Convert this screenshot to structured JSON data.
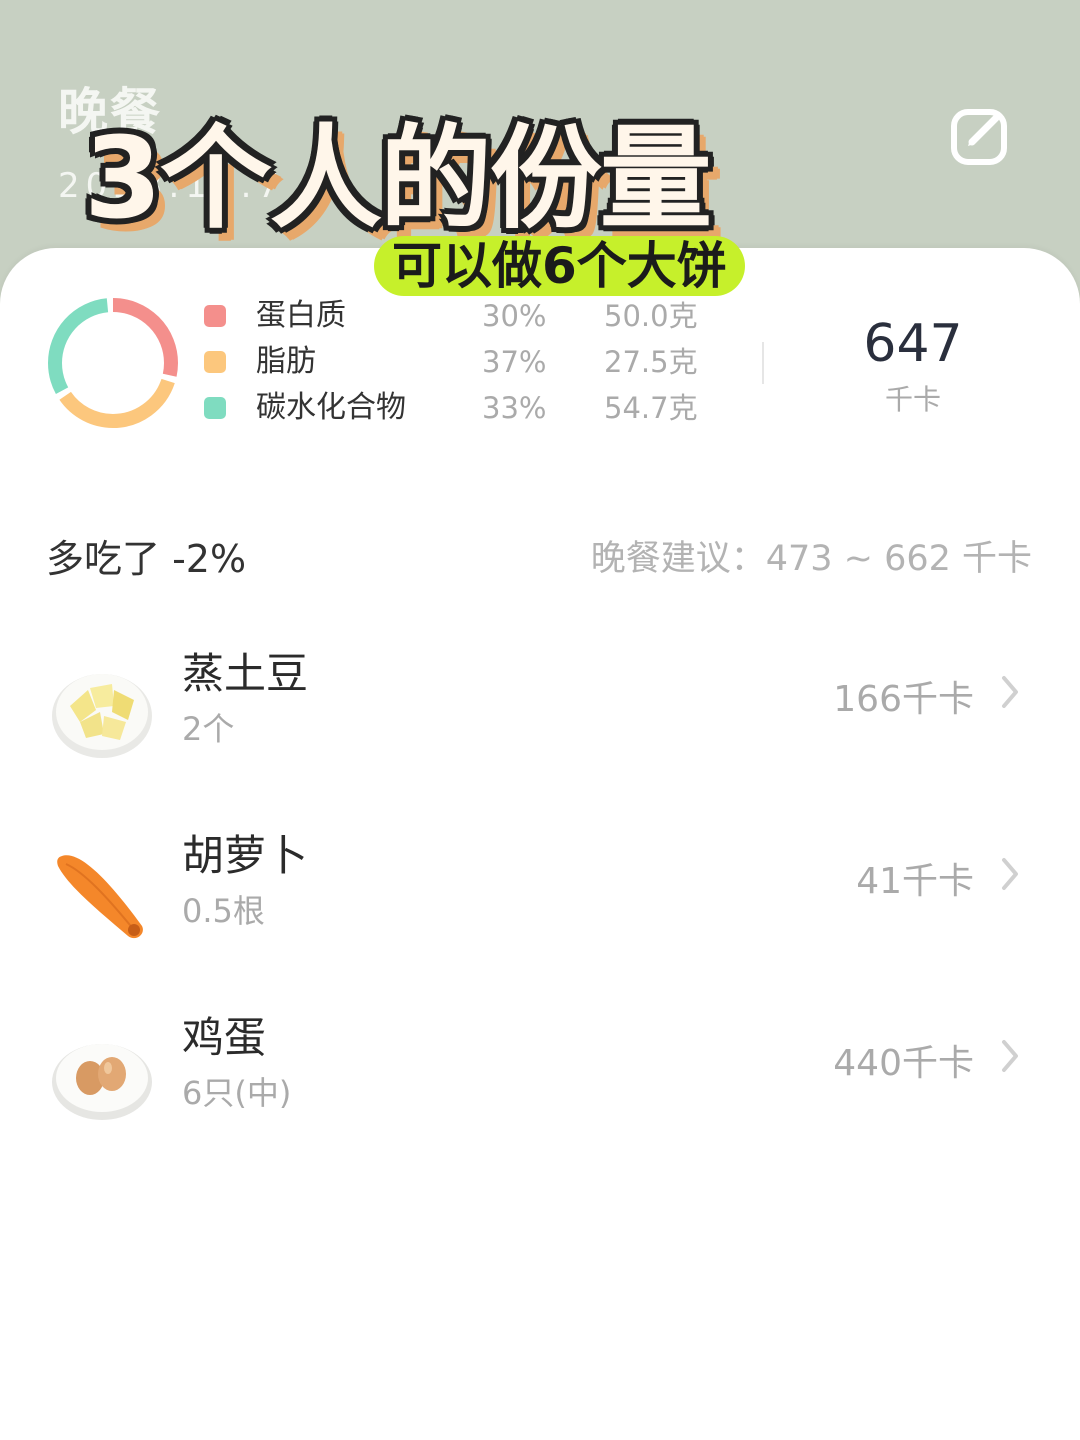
{
  "header": {
    "title": "晚餐",
    "date": "2023.10.7",
    "sticker_title": "3个人的份量",
    "sticker_subtitle": "可以做6个大饼",
    "edit_icon": "edit-icon",
    "background_color": "#c7d0c2"
  },
  "nutrition": {
    "items": [
      {
        "name": "蛋白质",
        "percent": "30%",
        "grams": "50.0克",
        "color": "#f48f8c",
        "share": 0.3
      },
      {
        "name": "脂肪",
        "percent": "37%",
        "grams": "27.5克",
        "color": "#fcc77d",
        "share": 0.37
      },
      {
        "name": "碳水化合物",
        "percent": "33%",
        "grams": "54.7克",
        "color": "#7fdcc0",
        "share": 0.33
      }
    ],
    "total_kcal": "647",
    "total_unit": "千卡"
  },
  "summary": {
    "over_text": "多吃了 -2%",
    "advice_text": "晚餐建议：473 ~ 662 千卡"
  },
  "foods": [
    {
      "name": "蒸土豆",
      "amount": "2个",
      "kcal": "166千卡",
      "icon": "steamed-potato-icon"
    },
    {
      "name": "胡萝卜",
      "amount": "0.5根",
      "kcal": "41千卡",
      "icon": "carrot-icon"
    },
    {
      "name": "鸡蛋",
      "amount": "6只(中)",
      "kcal": "440千卡",
      "icon": "egg-icon"
    }
  ]
}
